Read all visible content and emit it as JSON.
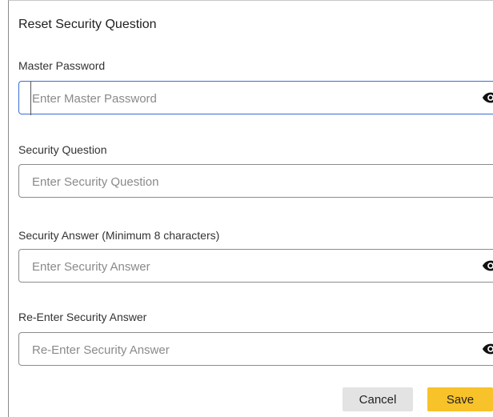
{
  "dialog": {
    "title": "Reset Security Question",
    "fields": [
      {
        "label": "Master Password",
        "placeholder": "Enter Master Password",
        "value": "",
        "reveal_icon": "eye-icon"
      },
      {
        "label": "Security Question",
        "placeholder": "Enter Security Question",
        "value": ""
      },
      {
        "label": "Security Answer (Minimum 8 characters)",
        "placeholder": "Enter Security Answer",
        "value": "",
        "reveal_icon": "eye-icon"
      },
      {
        "label": "Re-Enter Security Answer",
        "placeholder": "Re-Enter Security Answer",
        "value": "",
        "reveal_icon": "eye-icon"
      }
    ],
    "buttons": {
      "cancel": "Cancel",
      "save": "Save"
    },
    "colors": {
      "save_bg": "#f7c22a",
      "cancel_bg": "#e3e3e3",
      "focus_border": "#3a6fd8"
    }
  }
}
